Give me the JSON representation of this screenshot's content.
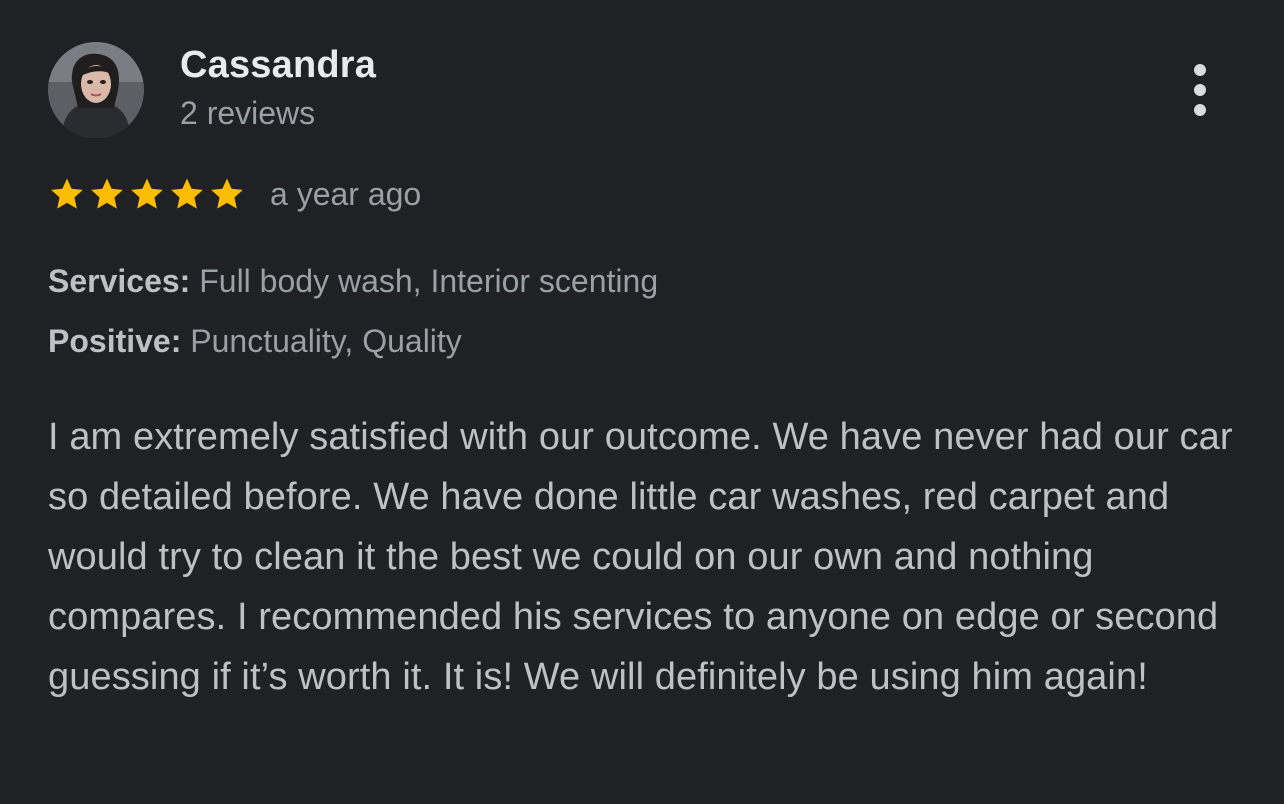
{
  "reviewer": {
    "name": "Cassandra",
    "review_count": "2 reviews",
    "avatar_icon": "user-avatar-photo"
  },
  "rating": {
    "stars": 5,
    "max_stars": 5,
    "star_color": "#fbbc04",
    "time_ago": "a year ago"
  },
  "details": {
    "services_label": "Services:",
    "services_value": "Full body wash, Interior scenting",
    "positive_label": "Positive:",
    "positive_value": "Punctuality, Quality"
  },
  "review": {
    "text": "I am extremely satisfied with our outcome. We have never had our car so detailed before. We have done little car washes, red carpet and would try to clean it the best we could on our own and nothing compares. I recommended his services to anyone on edge or second guessing if it’s worth it. It is! We will definitely be using him again!"
  },
  "menu": {
    "icon": "more-vert-icon"
  },
  "colors": {
    "background": "#202124",
    "primary_text": "#e8eaed",
    "secondary_text": "#9aa0a6",
    "body_text": "#bdc1c6"
  }
}
